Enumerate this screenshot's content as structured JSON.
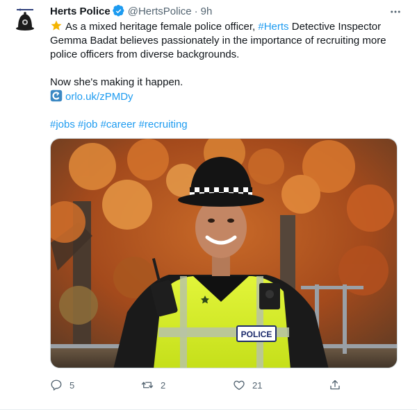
{
  "tweet": {
    "display_name": "Herts Police",
    "handle": "@HertsPolice",
    "separator": "·",
    "time": "9h",
    "body": {
      "line1_pre": "As a mixed heritage female police officer,",
      "line1_hashtag": "#Herts",
      "line1_post": "Detective Inspector",
      "line2": "Gemma Badat believes passionately in the importance of recruiting more",
      "line3": "police officers from diverse backgrounds.",
      "line4": "Now she's making it happen.",
      "link": "orlo.uk/zPMDy",
      "hashtags": [
        "#jobs",
        "#job",
        "#career",
        "#recruiting"
      ]
    },
    "media": {
      "vest_text": "POLICE"
    },
    "actions": {
      "reply_count": "5",
      "retweet_count": "2",
      "like_count": "21"
    },
    "icons": {
      "verified": "verified-badge-icon",
      "more": "more-options-icon",
      "reply": "reply-icon",
      "retweet": "retweet-icon",
      "like": "heart-icon",
      "share": "share-icon",
      "star": "star-emoji-icon",
      "link": "link-emoji-icon"
    },
    "colors": {
      "link_blue": "#1d9bf0",
      "verified_blue": "#1d9bf0",
      "muted_gray": "#536471",
      "hi_vis_yellow": "#d7ee1e"
    }
  }
}
